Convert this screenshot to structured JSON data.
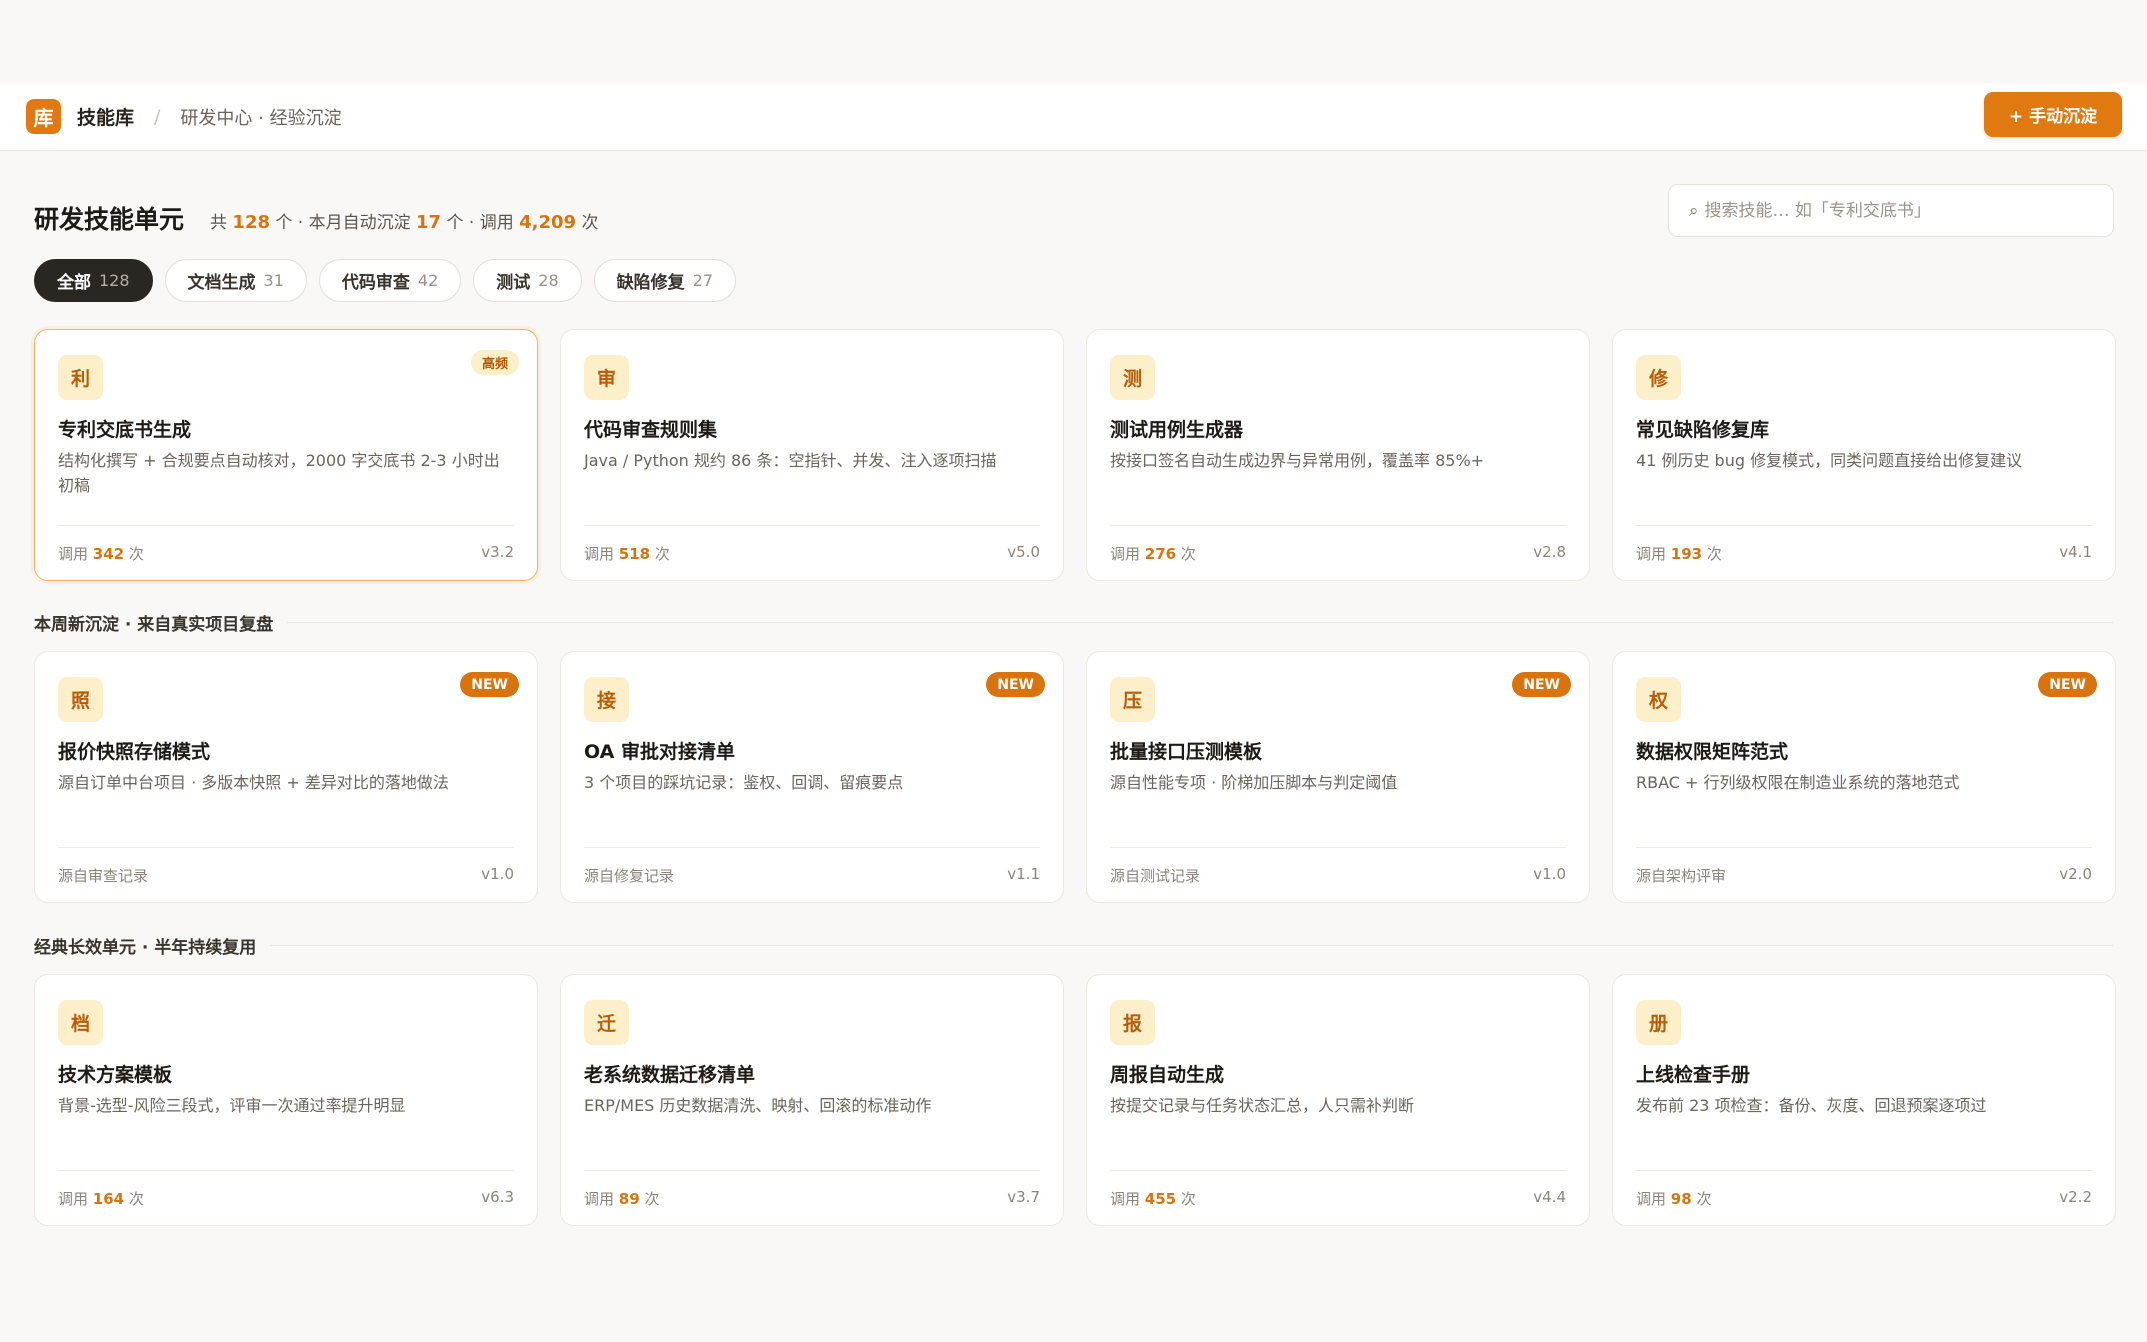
{
  "header": {
    "logo_char": "库",
    "app_title": "技能库",
    "separator": "/",
    "breadcrumb": "研发中心 · 经验沉淀",
    "primary_action": "+ 手动沉淀"
  },
  "page": {
    "title": "研发技能单元",
    "summary": {
      "pre": "共",
      "total": "128",
      "mid1": "个 · 本月自动沉淀",
      "monthly": "17",
      "mid2": "个 · 调用",
      "calls": "4,209",
      "post": "次"
    }
  },
  "search": {
    "placeholder": "搜索技能… 如「专利交底书」",
    "value": ""
  },
  "filters": [
    {
      "label": "全部",
      "count": "128",
      "active": true
    },
    {
      "label": "文档生成",
      "count": "31",
      "active": false
    },
    {
      "label": "代码审查",
      "count": "42",
      "active": false
    },
    {
      "label": "测试",
      "count": "28",
      "active": false
    },
    {
      "label": "缺陷修复",
      "count": "27",
      "active": false
    }
  ],
  "sections": {
    "new_week": "本周新沉淀 · 来自真实项目复盘",
    "classic": "经典长效单元 · 半年持续复用"
  },
  "cards_top": [
    {
      "icon": "利",
      "name": "专利交底书生成",
      "desc": "结构化撰写 + 合规要点自动核对，2000 字交底书 2-3 小时出初稿",
      "prefix": "调用",
      "calls": "342",
      "suffix": "次",
      "version": "v3.2",
      "tag": "高频"
    },
    {
      "icon": "审",
      "name": "代码审查规则集",
      "desc": "Java / Python 规约 86 条：空指针、并发、注入逐项扫描",
      "prefix": "调用",
      "calls": "518",
      "suffix": "次",
      "version": "v5.0"
    },
    {
      "icon": "测",
      "name": "测试用例生成器",
      "desc": "按接口签名自动生成边界与异常用例，覆盖率 85%+",
      "prefix": "调用",
      "calls": "276",
      "suffix": "次",
      "version": "v2.8"
    },
    {
      "icon": "修",
      "name": "常见缺陷修复库",
      "desc": "41 例历史 bug 修复模式，同类问题直接给出修复建议",
      "prefix": "调用",
      "calls": "193",
      "suffix": "次",
      "version": "v4.1"
    }
  ],
  "cards_new": [
    {
      "icon": "照",
      "name": "报价快照存储模式",
      "desc": "源自订单中台项目 · 多版本快照 + 差异对比的落地做法",
      "source": "源自审查记录",
      "version": "v1.0",
      "tag": "NEW"
    },
    {
      "icon": "接",
      "name": "OA 审批对接清单",
      "desc": "3 个项目的踩坑记录：鉴权、回调、留痕要点",
      "source": "源自修复记录",
      "version": "v1.1",
      "tag": "NEW"
    },
    {
      "icon": "压",
      "name": "批量接口压测模板",
      "desc": "源自性能专项 · 阶梯加压脚本与判定阈值",
      "source": "源自测试记录",
      "version": "v1.0",
      "tag": "NEW"
    },
    {
      "icon": "权",
      "name": "数据权限矩阵范式",
      "desc": "RBAC + 行列级权限在制造业系统的落地范式",
      "source": "源自架构评审",
      "version": "v2.0",
      "tag": "NEW"
    }
  ],
  "cards_classic": [
    {
      "icon": "档",
      "name": "技术方案模板",
      "desc": "背景-选型-风险三段式，评审一次通过率提升明显",
      "prefix": "调用",
      "calls": "164",
      "suffix": "次",
      "version": "v6.3"
    },
    {
      "icon": "迁",
      "name": "老系统数据迁移清单",
      "desc": "ERP/MES 历史数据清洗、映射、回滚的标准动作",
      "prefix": "调用",
      "calls": "89",
      "suffix": "次",
      "version": "v3.7"
    },
    {
      "icon": "报",
      "name": "周报自动生成",
      "desc": "按提交记录与任务状态汇总，人只需补判断",
      "prefix": "调用",
      "calls": "455",
      "suffix": "次",
      "version": "v4.4"
    },
    {
      "icon": "册",
      "name": "上线检查手册",
      "desc": "发布前 23 项检查：备份、灰度、回退预案逐项过",
      "prefix": "调用",
      "calls": "98",
      "suffix": "次",
      "version": "v2.2"
    }
  ],
  "colors": {
    "accent": "#e07a10",
    "accent_soft": "#fdefc9",
    "dark_chip": "#2a2622"
  }
}
